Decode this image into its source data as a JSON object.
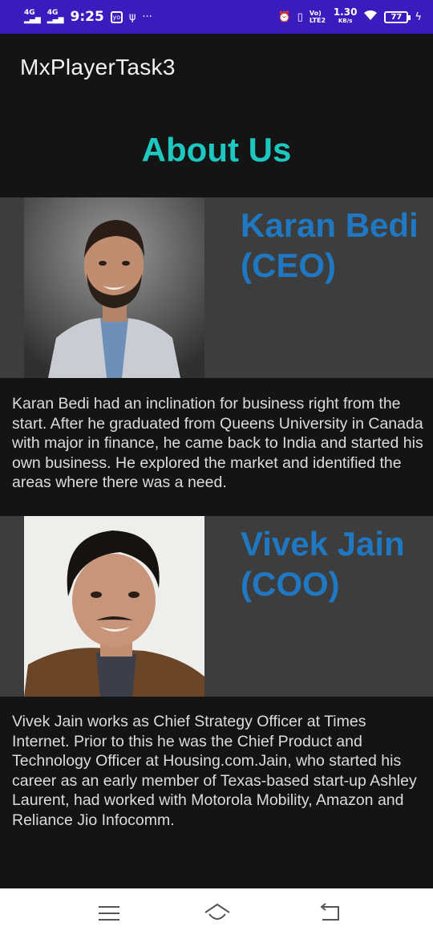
{
  "status_bar": {
    "network1": "4G",
    "network2": "4G",
    "time": "9:25",
    "overflow": "···",
    "speed_value": "1.30",
    "speed_unit": "KB/s",
    "volte": "Vo) LTE2",
    "battery": "77"
  },
  "app_bar": {
    "title": "MxPlayerTask3"
  },
  "page": {
    "heading": "About Us"
  },
  "people": [
    {
      "name_line1": "Karan Bedi",
      "name_line2": "(CEO)",
      "bio": "Karan Bedi had an inclination for business right from the start. After he graduated from Queens University in Canada with major in finance, he came back to India and started his own business. He explored the market and identified the areas where there was a need."
    },
    {
      "name_line1": "Vivek Jain",
      "name_line2": "(COO)",
      "bio": "Vivek Jain works as Chief Strategy Officer at Times Internet. Prior to this he was the Chief Product and Technology Officer at Housing.com.Jain, who started his career as an early member of Texas-based start-up Ashley Laurent, had worked with Motorola Mobility, Amazon and Reliance Jio Infocomm."
    }
  ],
  "nav_bar": {
    "icons": [
      "menu-icon",
      "home-icon",
      "back-icon"
    ]
  },
  "colors": {
    "status_bar": "#3a1bbd",
    "background": "#141414",
    "card": "#3d3d3d",
    "heading": "#1ec8c0",
    "name": "#1f78c1"
  }
}
